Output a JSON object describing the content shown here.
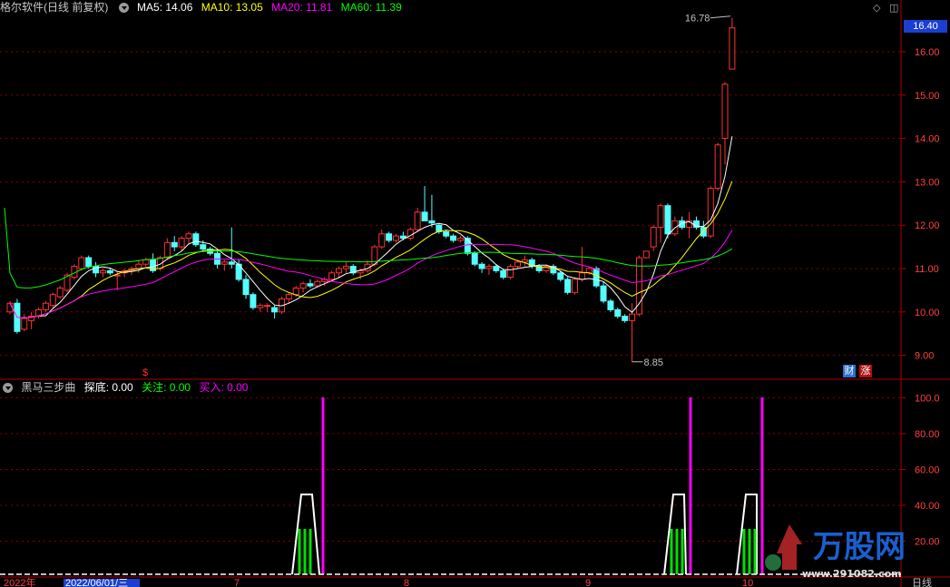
{
  "header": {
    "title": "格尔软件(日线 前复权)",
    "ma": [
      {
        "label": "MA5: 14.06",
        "color": "#ffffff"
      },
      {
        "label": "MA10: 13.05",
        "color": "#ffff00"
      },
      {
        "label": "MA20: 11.81",
        "color": "#ff00ff"
      },
      {
        "label": "MA60: 11.39",
        "color": "#00ff00"
      }
    ]
  },
  "indicator_header": {
    "title": "黑马三步曲",
    "items": [
      {
        "label": "探底: 0.00",
        "color": "#ffffff"
      },
      {
        "label": "关注: 0.00",
        "color": "#00ff00"
      },
      {
        "label": "买入: 0.00",
        "color": "#ff00ff"
      }
    ]
  },
  "price_axis": {
    "ticks": [
      "16.00",
      "15.00",
      "14.00",
      "13.00",
      "12.00",
      "11.00",
      "10.00",
      "9.00"
    ]
  },
  "indicator_axis": {
    "ticks": [
      "100.0",
      "80.00",
      "60.00",
      "40.00",
      "20.00"
    ]
  },
  "current_price": "16.40",
  "high_annotation": "16.78",
  "low_annotation": "8.85",
  "dollar_mark": "$",
  "badges": [
    {
      "label": "财",
      "color": "#2a6fd0"
    },
    {
      "label": "涨",
      "color": "#e03030"
    }
  ],
  "date_axis": {
    "items": [
      "2022年",
      "2022/06/01/三",
      "7",
      "8",
      "9",
      "10"
    ]
  },
  "bottom_right": "日线",
  "watermark": {
    "brand": "万股网",
    "url": "www.291082.com"
  },
  "colors": {
    "up": "#ff3232",
    "down": "#54ffff",
    "grid": "#8b0000",
    "axis": "#b00000"
  },
  "chart_data": {
    "type": "candlestick",
    "title": "格尔软件(日线 前复权)",
    "price_range": [
      8.6,
      17.0
    ],
    "candles": [
      [
        10.0,
        10.25,
        9.95,
        10.2
      ],
      [
        10.2,
        10.3,
        9.5,
        9.55
      ],
      [
        9.6,
        9.95,
        9.55,
        9.85
      ],
      [
        9.8,
        10.0,
        9.6,
        9.9
      ],
      [
        9.9,
        10.1,
        9.85,
        10.05
      ],
      [
        10.05,
        10.25,
        10.0,
        10.2
      ],
      [
        10.15,
        10.45,
        10.1,
        10.4
      ],
      [
        10.35,
        10.6,
        10.3,
        10.55
      ],
      [
        10.5,
        10.9,
        10.45,
        10.85
      ],
      [
        10.8,
        11.1,
        10.75,
        11.05
      ],
      [
        11.0,
        11.3,
        10.95,
        11.25
      ],
      [
        11.25,
        11.3,
        11.0,
        11.05
      ],
      [
        11.05,
        11.15,
        10.8,
        10.9
      ],
      [
        10.9,
        11.0,
        10.8,
        10.95
      ],
      [
        10.95,
        11.0,
        10.85,
        10.9
      ],
      [
        10.85,
        10.95,
        10.5,
        10.85
      ],
      [
        10.9,
        11.0,
        10.8,
        10.95
      ],
      [
        10.95,
        11.05,
        10.85,
        11.0
      ],
      [
        11.0,
        11.2,
        10.9,
        11.1
      ],
      [
        11.1,
        11.25,
        11.05,
        11.2
      ],
      [
        11.2,
        11.35,
        10.9,
        10.95
      ],
      [
        11.0,
        11.3,
        10.95,
        11.25
      ],
      [
        11.25,
        11.7,
        11.2,
        11.6
      ],
      [
        11.6,
        11.75,
        11.4,
        11.5
      ],
      [
        11.5,
        11.75,
        11.4,
        11.7
      ],
      [
        11.7,
        11.85,
        11.55,
        11.8
      ],
      [
        11.8,
        11.85,
        11.5,
        11.55
      ],
      [
        11.55,
        11.65,
        11.4,
        11.45
      ],
      [
        11.45,
        11.5,
        11.3,
        11.35
      ],
      [
        11.35,
        11.45,
        11.0,
        11.1
      ],
      [
        11.1,
        11.2,
        10.95,
        11.15
      ],
      [
        11.15,
        11.95,
        11.0,
        11.1
      ],
      [
        11.1,
        11.2,
        10.7,
        10.75
      ],
      [
        10.75,
        10.85,
        10.3,
        10.4
      ],
      [
        10.4,
        10.45,
        10.05,
        10.1
      ],
      [
        10.1,
        10.2,
        10.0,
        10.15
      ],
      [
        10.15,
        10.2,
        10.0,
        10.15
      ],
      [
        10.1,
        10.15,
        9.85,
        10.0
      ],
      [
        10.0,
        10.35,
        9.95,
        10.3
      ],
      [
        10.3,
        10.45,
        10.2,
        10.4
      ],
      [
        10.4,
        10.6,
        10.35,
        10.55
      ],
      [
        10.55,
        10.7,
        10.45,
        10.65
      ],
      [
        10.65,
        10.75,
        10.55,
        10.6
      ],
      [
        10.6,
        10.75,
        10.55,
        10.7
      ],
      [
        10.7,
        10.8,
        10.6,
        10.75
      ],
      [
        10.75,
        10.95,
        10.7,
        10.9
      ],
      [
        10.9,
        11.05,
        10.8,
        11.0
      ],
      [
        11.0,
        11.15,
        10.9,
        11.05
      ],
      [
        11.05,
        11.1,
        10.85,
        10.9
      ],
      [
        10.9,
        11.0,
        10.75,
        10.95
      ],
      [
        10.95,
        11.2,
        10.9,
        11.1
      ],
      [
        11.1,
        11.55,
        11.05,
        11.5
      ],
      [
        11.5,
        11.9,
        11.45,
        11.8
      ],
      [
        11.8,
        11.85,
        11.6,
        11.65
      ],
      [
        11.65,
        11.8,
        11.6,
        11.75
      ],
      [
        11.75,
        11.85,
        11.65,
        11.7
      ],
      [
        11.7,
        11.95,
        11.65,
        11.9
      ],
      [
        11.9,
        12.4,
        11.85,
        12.3
      ],
      [
        12.3,
        12.9,
        12.25,
        12.1
      ],
      [
        12.1,
        12.7,
        11.95,
        12.05
      ],
      [
        12.0,
        12.05,
        11.8,
        11.85
      ],
      [
        11.85,
        11.9,
        11.7,
        11.75
      ],
      [
        11.75,
        11.8,
        11.6,
        11.65
      ],
      [
        11.65,
        11.75,
        11.6,
        11.7
      ],
      [
        11.7,
        11.75,
        11.3,
        11.35
      ],
      [
        11.35,
        11.4,
        11.05,
        11.1
      ],
      [
        11.1,
        11.15,
        10.9,
        11.0
      ],
      [
        11.0,
        11.1,
        10.85,
        11.05
      ],
      [
        11.05,
        11.1,
        10.9,
        10.95
      ],
      [
        10.95,
        11.0,
        10.75,
        10.8
      ],
      [
        10.8,
        11.1,
        10.75,
        11.05
      ],
      [
        11.05,
        11.2,
        11.0,
        11.15
      ],
      [
        11.15,
        11.3,
        11.05,
        11.2
      ],
      [
        11.2,
        11.25,
        11.0,
        11.05
      ],
      [
        11.05,
        11.1,
        10.9,
        10.95
      ],
      [
        10.95,
        11.1,
        10.9,
        11.05
      ],
      [
        11.05,
        11.1,
        10.85,
        10.9
      ],
      [
        10.9,
        10.95,
        10.7,
        10.75
      ],
      [
        10.75,
        10.8,
        10.4,
        10.45
      ],
      [
        10.45,
        10.8,
        10.4,
        10.75
      ],
      [
        10.75,
        11.5,
        10.7,
        10.9
      ],
      [
        10.9,
        11.05,
        10.85,
        11.0
      ],
      [
        11.0,
        11.05,
        10.55,
        10.6
      ],
      [
        10.6,
        10.7,
        10.2,
        10.25
      ],
      [
        10.25,
        10.3,
        10.0,
        10.05
      ],
      [
        10.05,
        10.1,
        9.85,
        9.9
      ],
      [
        9.9,
        9.95,
        9.75,
        9.8
      ],
      [
        9.8,
        10.2,
        8.85,
        9.95
      ],
      [
        9.95,
        11.3,
        9.9,
        11.25
      ],
      [
        11.25,
        11.35,
        11.4,
        11.4
      ],
      [
        11.5,
        12.0,
        11.4,
        11.95
      ],
      [
        11.95,
        12.5,
        11.6,
        12.45
      ],
      [
        12.45,
        12.5,
        11.7,
        11.8
      ],
      [
        11.8,
        12.2,
        11.75,
        12.1
      ],
      [
        12.1,
        12.2,
        11.9,
        11.95
      ],
      [
        11.95,
        12.3,
        11.7,
        12.1
      ],
      [
        12.1,
        12.2,
        11.9,
        11.95
      ],
      [
        11.95,
        12.1,
        11.7,
        11.75
      ],
      [
        11.75,
        12.9,
        11.7,
        12.85
      ],
      [
        12.85,
        13.9,
        12.8,
        13.85
      ],
      [
        14.0,
        15.3,
        13.4,
        15.25
      ],
      [
        15.6,
        16.78,
        15.6,
        16.55
      ]
    ]
  }
}
